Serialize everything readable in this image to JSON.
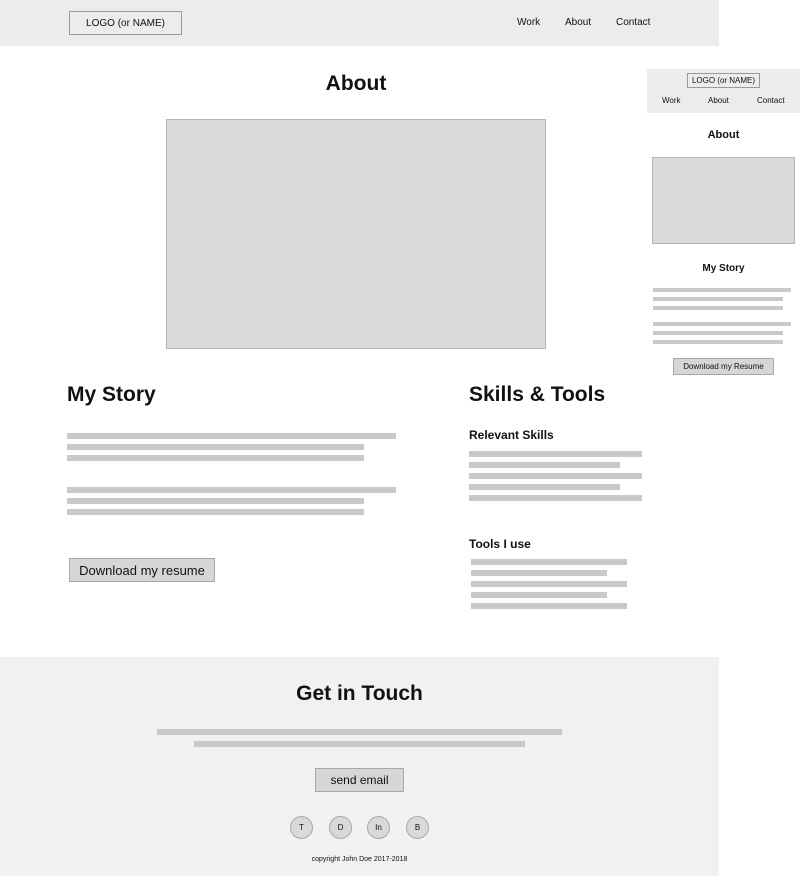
{
  "desktop": {
    "header": {
      "logo": "LOGO (or NAME)",
      "nav": [
        "Work",
        "About",
        "Contact"
      ]
    },
    "about_title": "About",
    "story": {
      "title": "My Story",
      "button": "Download my resume"
    },
    "skills": {
      "title": "Skills & Tools",
      "relevant_title": "Relevant Skills",
      "tools_title": "Tools I use"
    },
    "footer": {
      "title": "Get in Touch",
      "button": "send email",
      "social": [
        "T",
        "D",
        "In",
        "B"
      ],
      "copyright": "copyright John Doe 2017-2018"
    }
  },
  "mobile": {
    "header": {
      "logo": "LOGO (or NAME)",
      "nav": [
        "Work",
        "About",
        "Contact"
      ]
    },
    "about_title": "About",
    "story_title": "My Story",
    "button": "Download my Resume"
  }
}
